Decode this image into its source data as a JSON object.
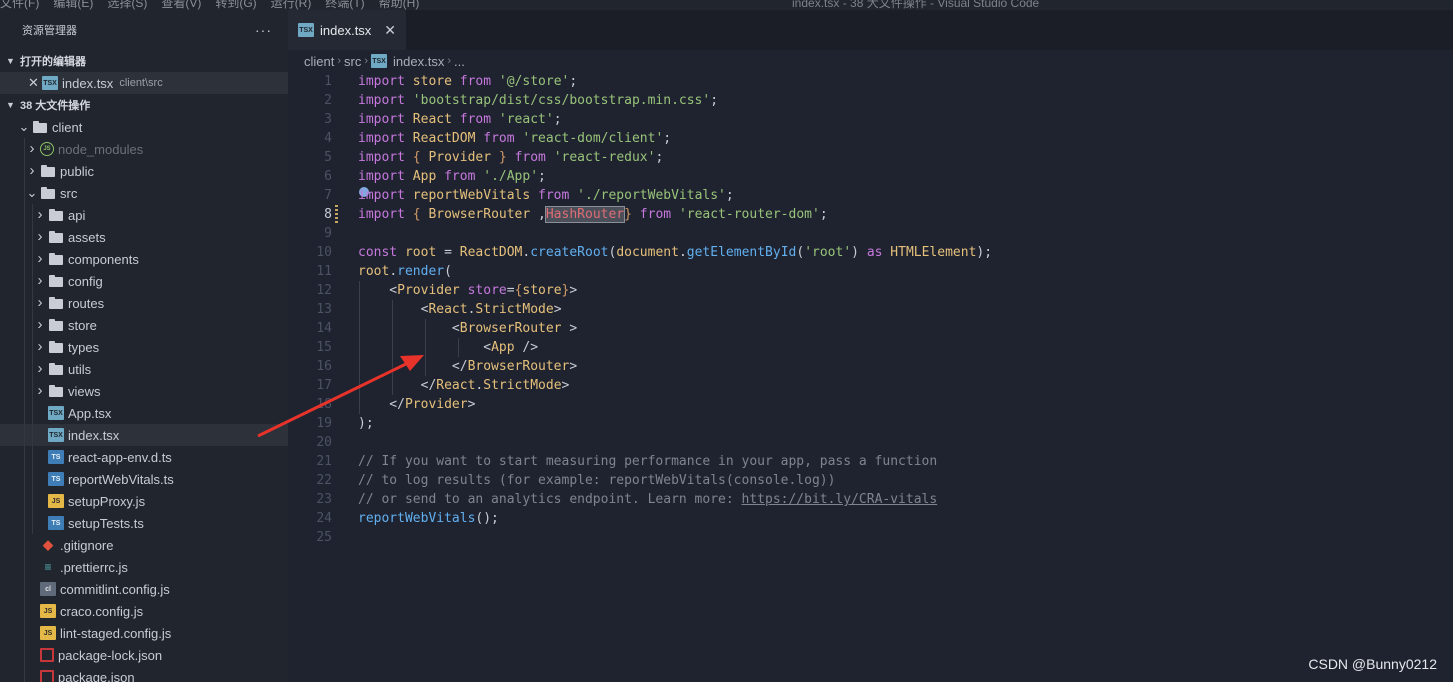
{
  "menu": [
    "文件(F)",
    "编辑(E)",
    "选择(S)",
    "查看(V)",
    "转到(G)",
    "运行(R)",
    "终端(T)",
    "帮助(H)"
  ],
  "window_title": "index.tsx - 38 大文件操作 - Visual Studio Code",
  "sidebar": {
    "title": "资源管理器",
    "more": "···",
    "open_editors": {
      "header": "打开的编辑器",
      "file": "index.tsx",
      "path": "client\\src"
    },
    "workspace": {
      "header": "38 大文件操作",
      "items": [
        {
          "label": "client"
        },
        {
          "label": "node_modules"
        },
        {
          "label": "public"
        },
        {
          "label": "src"
        },
        {
          "label": "api"
        },
        {
          "label": "assets"
        },
        {
          "label": "components"
        },
        {
          "label": "config"
        },
        {
          "label": "routes"
        },
        {
          "label": "store"
        },
        {
          "label": "types"
        },
        {
          "label": "utils"
        },
        {
          "label": "views"
        },
        {
          "label": "App.tsx"
        },
        {
          "label": "index.tsx"
        },
        {
          "label": "react-app-env.d.ts"
        },
        {
          "label": "reportWebVitals.ts"
        },
        {
          "label": "setupProxy.js"
        },
        {
          "label": "setupTests.ts"
        },
        {
          "label": ".gitignore"
        },
        {
          "label": ".prettierrc.js"
        },
        {
          "label": "commitlint.config.js"
        },
        {
          "label": "craco.config.js"
        },
        {
          "label": "lint-staged.config.js"
        },
        {
          "label": "package-lock.json"
        },
        {
          "label": "package.json"
        }
      ]
    }
  },
  "tab": {
    "label": "index.tsx",
    "close": "✕",
    "icon_text": "TSX"
  },
  "breadcrumb": {
    "parts": [
      "client",
      "src",
      "index.tsx",
      "..."
    ],
    "sep": "›"
  },
  "icons": {
    "tsx": "TSX",
    "ts": "TS",
    "js": "JS",
    "node": "JS",
    "cl": "cl",
    "git": "◆",
    "prettier": "≡"
  },
  "editor": {
    "line_numbers": [
      "1",
      "2",
      "3",
      "4",
      "5",
      "6",
      "7",
      "8",
      "9",
      "10",
      "11",
      "12",
      "13",
      "14",
      "15",
      "16",
      "17",
      "18",
      "19",
      "20",
      "21",
      "22",
      "23",
      "24",
      "25"
    ],
    "active_line": "8",
    "lines": [
      [
        [
          "kw",
          "import "
        ],
        [
          "vr",
          "store "
        ],
        [
          "kw",
          "from "
        ],
        [
          "st",
          "'@/store'"
        ],
        [
          "pn",
          ";"
        ]
      ],
      [
        [
          "kw",
          "import "
        ],
        [
          "st",
          "'bootstrap/dist/css/bootstrap.min.css'"
        ],
        [
          "pn",
          ";"
        ]
      ],
      [
        [
          "kw",
          "import "
        ],
        [
          "vr",
          "React "
        ],
        [
          "kw",
          "from "
        ],
        [
          "st",
          "'react'"
        ],
        [
          "pn",
          ";"
        ]
      ],
      [
        [
          "kw",
          "import "
        ],
        [
          "vr",
          "ReactDOM "
        ],
        [
          "kw",
          "from "
        ],
        [
          "st",
          "'react-dom/client'"
        ],
        [
          "pn",
          ";"
        ]
      ],
      [
        [
          "kw",
          "import "
        ],
        [
          "br",
          "{ "
        ],
        [
          "vr",
          "Provider "
        ],
        [
          "br",
          "} "
        ],
        [
          "kw",
          "from "
        ],
        [
          "st",
          "'react-redux'"
        ],
        [
          "pn",
          ";"
        ]
      ],
      [
        [
          "kw",
          "import "
        ],
        [
          "vr",
          "App "
        ],
        [
          "kw",
          "from "
        ],
        [
          "st",
          "'./App'"
        ],
        [
          "pn",
          ";"
        ]
      ],
      [
        [
          "kw",
          "import "
        ],
        [
          "vr",
          "reportWebVitals "
        ],
        [
          "kw",
          "from "
        ],
        [
          "st",
          "'./reportWebVitals'"
        ],
        [
          "pn",
          ";"
        ]
      ],
      [
        [
          "kw",
          "import "
        ],
        [
          "br",
          "{ "
        ],
        [
          "vr",
          "BrowserRouter "
        ],
        [
          "pn",
          ","
        ],
        [
          "hl",
          "HashRouter"
        ],
        [
          "br",
          "} "
        ],
        [
          "kw",
          "from "
        ],
        [
          "st",
          "'react-router-dom'"
        ],
        [
          "pn",
          ";"
        ]
      ],
      [],
      [
        [
          "kw",
          "const "
        ],
        [
          "vr",
          "root "
        ],
        [
          "pn",
          "= "
        ],
        [
          "vr",
          "ReactDOM"
        ],
        [
          "pn",
          "."
        ],
        [
          "fn",
          "createRoot"
        ],
        [
          "pn",
          "("
        ],
        [
          "vr",
          "document"
        ],
        [
          "pn",
          "."
        ],
        [
          "fn",
          "getElementById"
        ],
        [
          "pn",
          "("
        ],
        [
          "st",
          "'root'"
        ],
        [
          "pn",
          ") "
        ],
        [
          "kw",
          "as "
        ],
        [
          "vr",
          "HTMLElement"
        ],
        [
          "pn",
          ");"
        ]
      ],
      [
        [
          "vr",
          "root"
        ],
        [
          "pn",
          "."
        ],
        [
          "fn",
          "render"
        ],
        [
          "pn",
          "("
        ]
      ],
      [
        [
          "pn",
          "    <"
        ],
        [
          "tg",
          "Provider "
        ],
        [
          "at",
          "store"
        ],
        [
          "pn",
          "="
        ],
        [
          "br",
          "{"
        ],
        [
          "vr",
          "store"
        ],
        [
          "br",
          "}"
        ],
        [
          "pn",
          ">"
        ]
      ],
      [
        [
          "pn",
          "        <"
        ],
        [
          "tg",
          "React"
        ],
        [
          "pn",
          "."
        ],
        [
          "tg",
          "StrictMode"
        ],
        [
          "pn",
          ">"
        ]
      ],
      [
        [
          "pn",
          "            <"
        ],
        [
          "tg",
          "BrowserRouter "
        ],
        [
          "pn",
          ">"
        ]
      ],
      [
        [
          "pn",
          "                <"
        ],
        [
          "tg",
          "App "
        ],
        [
          "pn",
          "/>"
        ]
      ],
      [
        [
          "pn",
          "            </"
        ],
        [
          "tg",
          "BrowserRouter"
        ],
        [
          "pn",
          ">"
        ]
      ],
      [
        [
          "pn",
          "        </"
        ],
        [
          "tg",
          "React"
        ],
        [
          "pn",
          "."
        ],
        [
          "tg",
          "StrictMode"
        ],
        [
          "pn",
          ">"
        ]
      ],
      [
        [
          "pn",
          "    </"
        ],
        [
          "tg",
          "Provider"
        ],
        [
          "pn",
          ">"
        ]
      ],
      [
        [
          "pn",
          ");"
        ]
      ],
      [],
      [
        [
          "cm",
          "// If you want to start measuring performance in your app, pass a function"
        ]
      ],
      [
        [
          "cm",
          "// to log results (for example: reportWebVitals(console.log))"
        ]
      ],
      [
        [
          "cm",
          "// or send to an analytics endpoint. Learn more: "
        ],
        [
          "url",
          "https://bit.ly/CRA-vitals"
        ]
      ],
      [
        [
          "fn",
          "reportWebVitals"
        ],
        [
          "pn",
          "();"
        ]
      ],
      []
    ]
  },
  "watermark": "CSDN @Bunny0212",
  "colors": {
    "annotation_arrow": "#e8332a",
    "sidebar_bg": "#21252e",
    "editor_bg": "#1f2330"
  }
}
